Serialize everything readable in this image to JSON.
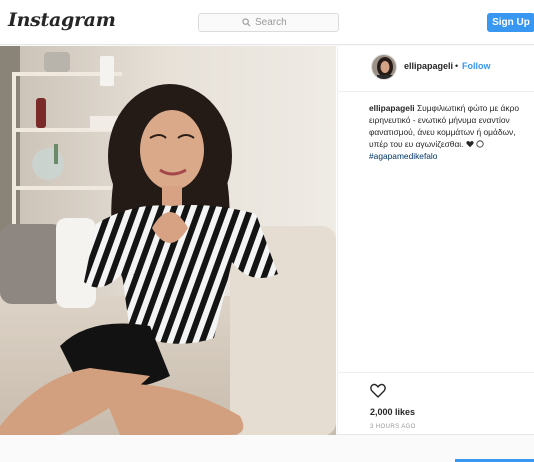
{
  "header": {
    "logo": "Instagram",
    "search_placeholder": "Search",
    "signup_label": "Sign Up"
  },
  "post": {
    "username": "ellipapageli",
    "follow_label": "Follow",
    "separator": "•",
    "caption_user": "ellipapageli",
    "caption_lines": [
      "Συμφιλιωτική φώτο με άκρο",
      "ειρηνευτικό - ενωτικό μήνυμα εναντίον",
      "φανατισμού, άνευ κομμάτων ή ομάδων,",
      "υπέρ του ευ αγωνίζεσθαι."
    ],
    "hashtag": "#agapamedikefalo",
    "likes": "2,000 likes",
    "time": "3 HOURS AGO"
  },
  "icons": {
    "search": "search-icon",
    "like": "heart-outline-icon",
    "caption_heart": "black-heart-emoji",
    "caption_circle": "white-circle-emoji"
  },
  "colors": {
    "accent": "#3897f0",
    "text": "#262626",
    "muted": "#999999",
    "hashtag": "#003569"
  }
}
